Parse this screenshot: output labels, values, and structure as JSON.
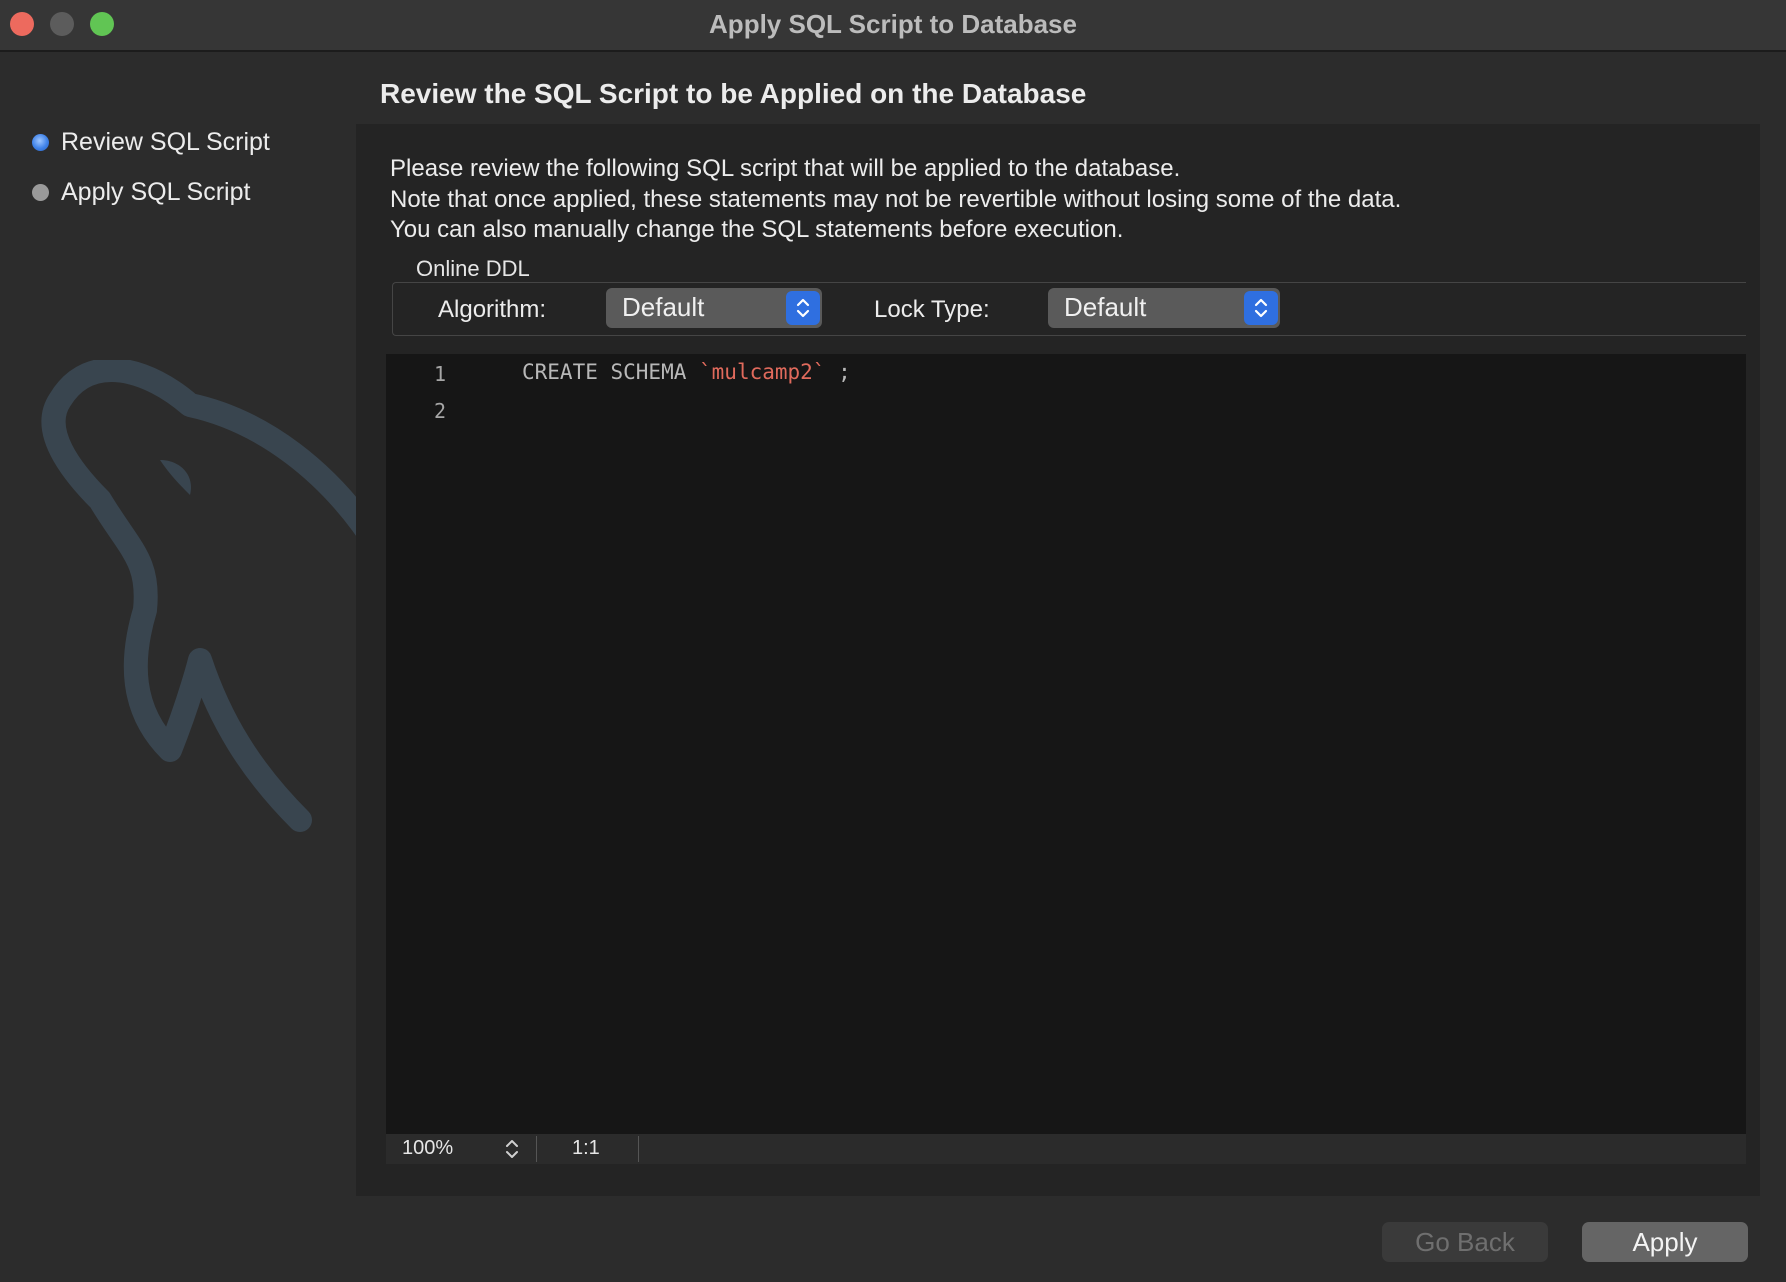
{
  "window": {
    "title": "Apply SQL Script to Database"
  },
  "sidebar": {
    "steps": [
      {
        "label": "Review SQL Script",
        "state": "active"
      },
      {
        "label": "Apply SQL Script",
        "state": "inactive"
      }
    ],
    "logo": "mysql-dolphin-watermark"
  },
  "page": {
    "title": "Review the SQL Script to be Applied on the Database",
    "description": [
      "Please review the following SQL script that will be applied to the database.",
      "Note that once applied, these statements may not be revertible without losing some of the data.",
      "You can also manually change the SQL statements before execution."
    ]
  },
  "online_ddl": {
    "label": "Online DDL",
    "algorithm_label": "Algorithm:",
    "algorithm_value": "Default",
    "lock_type_label": "Lock Type:",
    "lock_type_value": "Default"
  },
  "editor": {
    "lines": [
      {
        "num": "1",
        "keyword": "CREATE SCHEMA ",
        "identifier": "`mulcamp2`",
        "rest": " ;"
      },
      {
        "num": "2",
        "keyword": "",
        "identifier": "",
        "rest": ""
      }
    ]
  },
  "statusbar": {
    "zoom": "100%",
    "cursor": "1:1"
  },
  "buttons": {
    "back": "Go Back",
    "apply": "Apply"
  },
  "colors": {
    "accent": "#2f6fe0",
    "string": "#e06a5c",
    "close": "#ed6a5e",
    "maximize": "#61c554"
  }
}
